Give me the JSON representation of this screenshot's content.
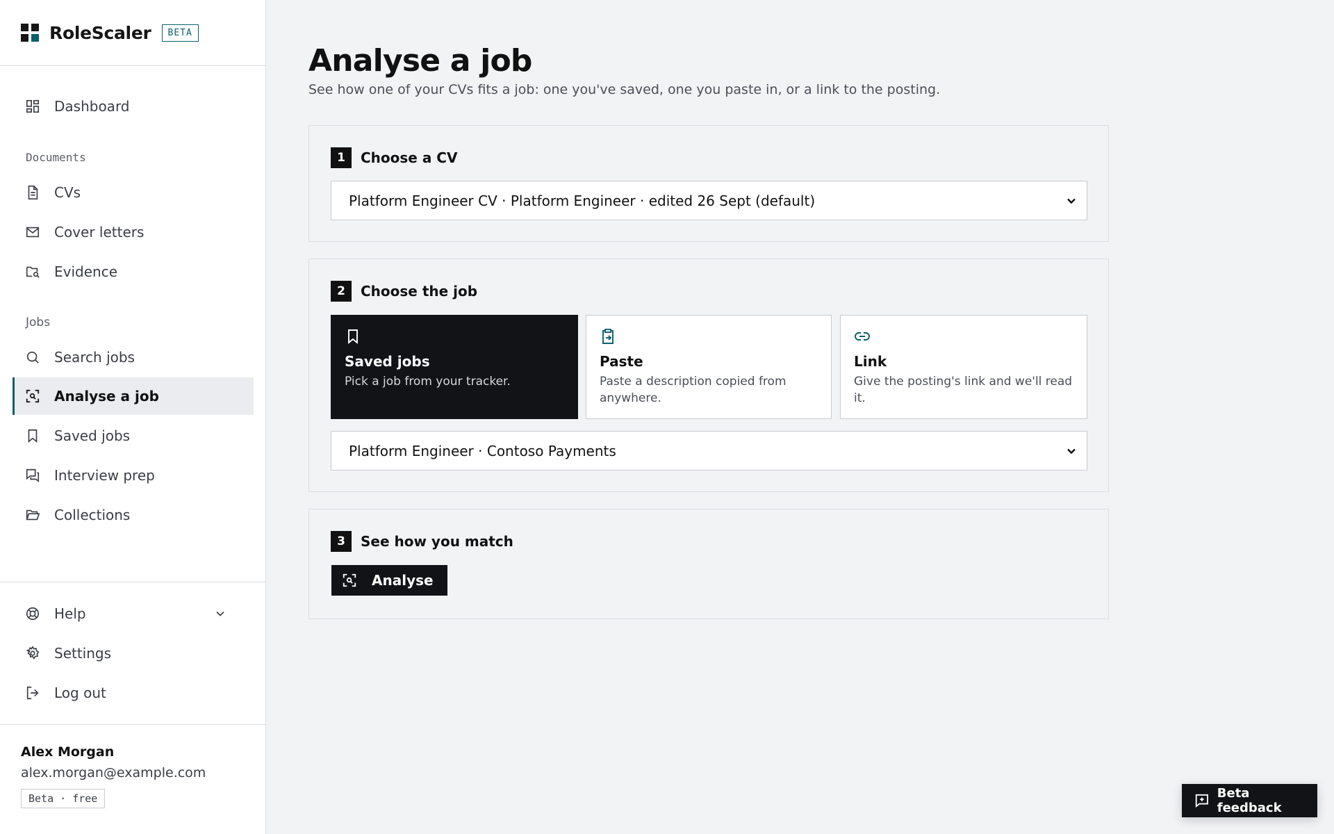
{
  "brand": {
    "name": "RoleScaler",
    "badge": "BETA"
  },
  "sidebar": {
    "dashboard": "Dashboard",
    "sections": {
      "documents": "Documents",
      "jobs": "Jobs"
    },
    "documents": [
      "CVs",
      "Cover letters",
      "Evidence"
    ],
    "jobs": [
      "Search jobs",
      "Analyse a job",
      "Saved jobs",
      "Interview prep",
      "Collections"
    ],
    "active_item": "Analyse a job",
    "bottom": {
      "help": "Help",
      "settings": "Settings",
      "logout": "Log out"
    },
    "user": {
      "name": "Alex Morgan",
      "email": "alex.morgan@example.com",
      "plan": "Beta · free"
    }
  },
  "page": {
    "title": "Analyse a job",
    "subtitle": "See how one of your CVs fits a job: one you've saved, one you paste in, or a link to the posting."
  },
  "steps": {
    "cv": {
      "number": "1",
      "title": "Choose a CV",
      "selected": "Platform Engineer CV · Platform Engineer · edited 26 Sept (default)"
    },
    "job": {
      "number": "2",
      "title": "Choose the job",
      "options": [
        {
          "title": "Saved jobs",
          "desc": "Pick a job from your tracker.",
          "icon": "bookmark-icon",
          "selected": true
        },
        {
          "title": "Paste",
          "desc": "Paste a description copied from anywhere.",
          "icon": "clipboard-icon",
          "selected": false
        },
        {
          "title": "Link",
          "desc": "Give the posting's link and we'll read it.",
          "icon": "link-icon",
          "selected": false
        }
      ],
      "selected": "Platform Engineer · Contoso Payments"
    },
    "match": {
      "number": "3",
      "title": "See how you match",
      "button": "Analyse"
    }
  },
  "feedback": {
    "label": "Beta feedback"
  },
  "colors": {
    "accent": "#0b5f6b",
    "dark": "#111317",
    "background": "#f2f3f5"
  }
}
